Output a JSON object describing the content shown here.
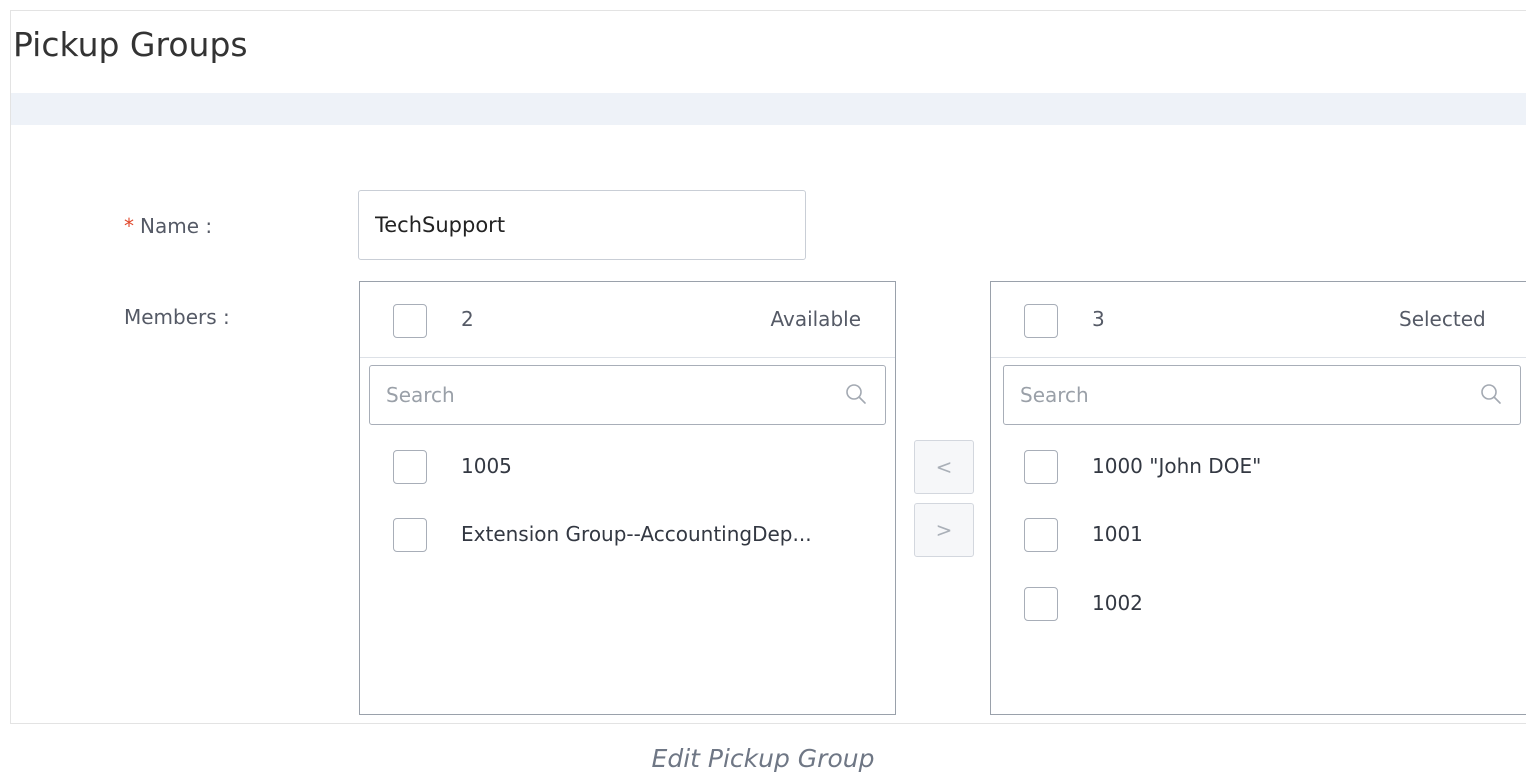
{
  "page": {
    "title": "Pickup Groups"
  },
  "form": {
    "name_required_mark": "*",
    "name_label": "Name :",
    "name_value": "TechSupport",
    "members_label": "Members :"
  },
  "available": {
    "count": "2",
    "title": "Available",
    "search_placeholder": "Search",
    "items": [
      {
        "label": "1005",
        "checked": false
      },
      {
        "label": "Extension Group--AccountingDep...",
        "checked": false
      }
    ]
  },
  "selected": {
    "count": "3",
    "title": "Selected",
    "search_placeholder": "Search",
    "items": [
      {
        "label": "1000 \"John DOE\"",
        "checked": false
      },
      {
        "label": "1001",
        "checked": false
      },
      {
        "label": "1002",
        "checked": false
      }
    ]
  },
  "operations": {
    "move_left_glyph": "<",
    "move_right_glyph": ">"
  },
  "caption": "Edit Pickup Group",
  "icons": {
    "search": "search-icon"
  },
  "colors": {
    "required": "#e0472b",
    "border": "#9aa1ab",
    "title_band": "#eef2f8"
  }
}
